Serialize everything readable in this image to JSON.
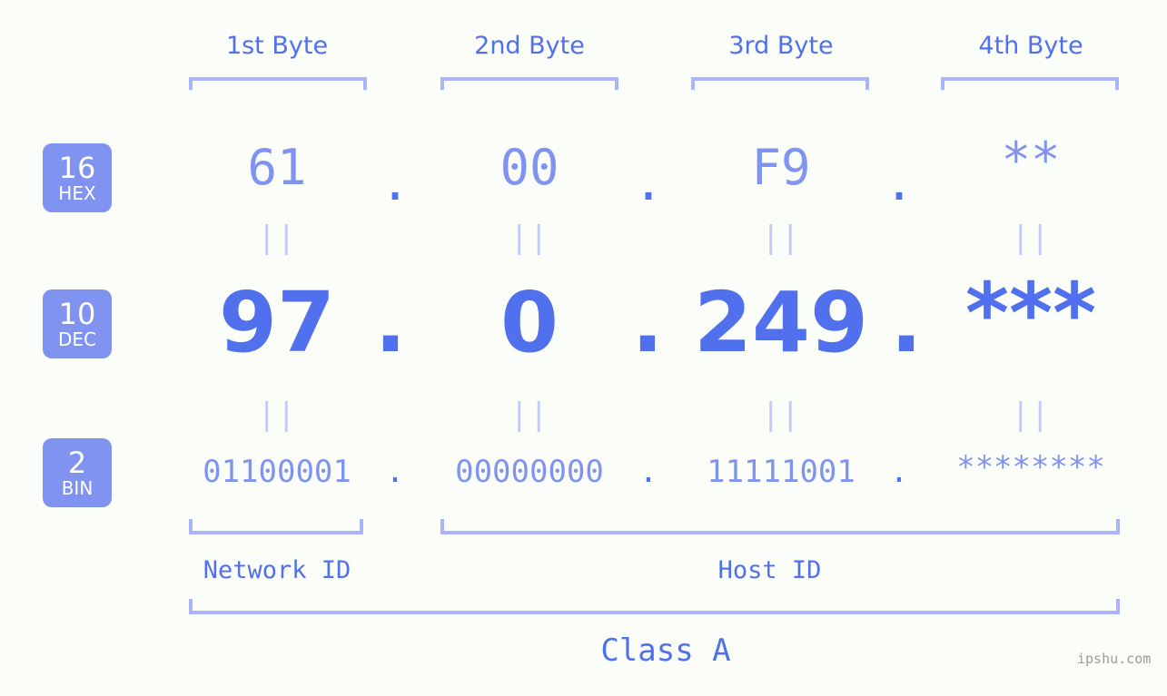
{
  "meta": {
    "watermark": "ipshu.com",
    "background_color": "#fbfdf8",
    "accent_color": "#5170ee",
    "light_accent_color": "#aab4f8",
    "badge_color": "#8193f0"
  },
  "byte_headers": [
    {
      "label": "1st Byte"
    },
    {
      "label": "2nd Byte"
    },
    {
      "label": "3rd Byte"
    },
    {
      "label": "4th Byte"
    }
  ],
  "bases": [
    {
      "number": "16",
      "name": "HEX"
    },
    {
      "number": "10",
      "name": "DEC"
    },
    {
      "number": "2",
      "name": "BIN"
    }
  ],
  "rows": {
    "hex": {
      "b1": "61",
      "b2": "00",
      "b3": "F9",
      "b4": "**"
    },
    "dec": {
      "b1": "97",
      "b2": "0",
      "b3": "249",
      "b4": "***"
    },
    "bin": {
      "b1": "01100001",
      "b2": "00000000",
      "b3": "11111001",
      "b4": "********"
    }
  },
  "separators": {
    "dot": ".",
    "equals": "||"
  },
  "sections": [
    {
      "label": "Network ID"
    },
    {
      "label": "Host ID"
    }
  ],
  "class": {
    "label": "Class A"
  }
}
